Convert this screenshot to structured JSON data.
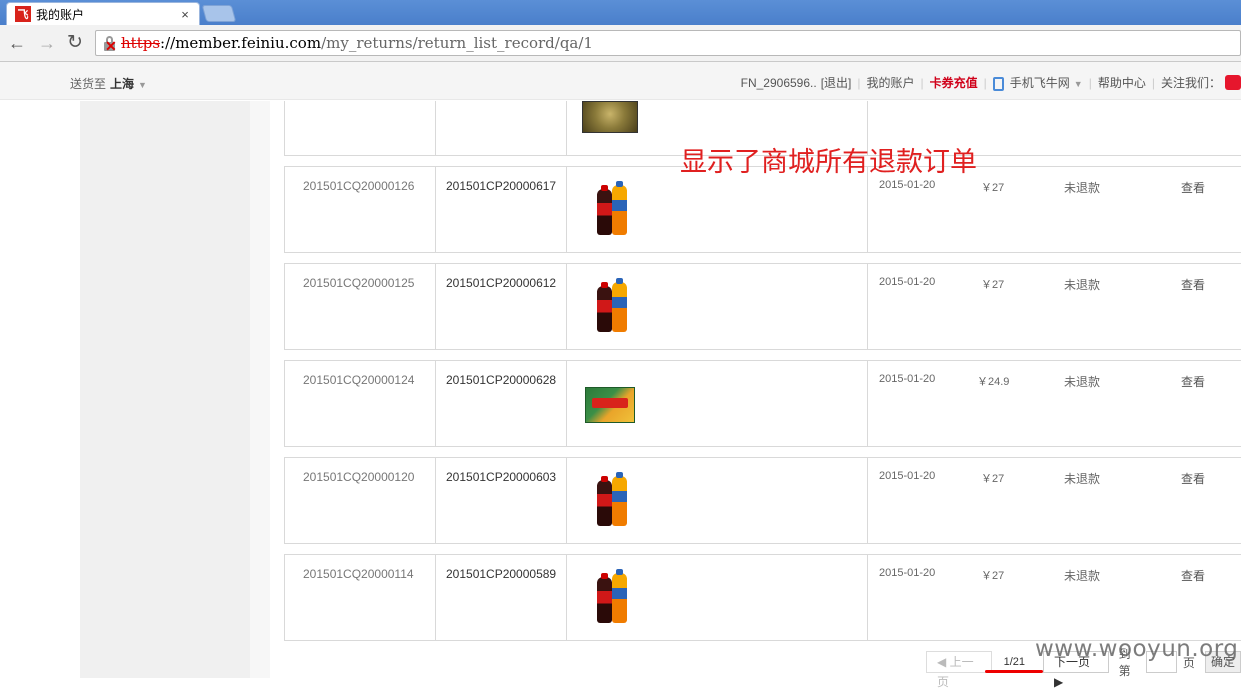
{
  "browser": {
    "tab_title": "我的账户",
    "tab_favicon_text": "飞",
    "tab_close": "×",
    "url_scheme": "https",
    "url_host": "://member.feiniu.com",
    "url_path": "/my_returns/return_list_record/qa/1"
  },
  "topbar": {
    "deliver_label": "送货至",
    "deliver_city": "上海",
    "username": "FN_2906596..",
    "logout": "[退出]",
    "my_account": "我的账户",
    "card_recharge": "卡券充值",
    "mobile_site": "手机飞牛网",
    "help_center": "帮助中心",
    "follow_us": "关注我们："
  },
  "annotation": "显示了商城所有退款订单",
  "orders": [
    {
      "return_no": "201501CQ20000126",
      "order_no": "201501CP20000617",
      "date": "2015-01-20",
      "amount": "￥27",
      "status": "未退款",
      "action": "查看",
      "product": "drinks"
    },
    {
      "return_no": "201501CQ20000125",
      "order_no": "201501CP20000612",
      "date": "2015-01-20",
      "amount": "￥27",
      "status": "未退款",
      "action": "查看",
      "product": "drinks"
    },
    {
      "return_no": "201501CQ20000124",
      "order_no": "201501CP20000628",
      "date": "2015-01-20",
      "amount": "￥24.9",
      "status": "未退款",
      "action": "查看",
      "product": "snack-box"
    },
    {
      "return_no": "201501CQ20000120",
      "order_no": "201501CP20000603",
      "date": "2015-01-20",
      "amount": "￥27",
      "status": "未退款",
      "action": "查看",
      "product": "drinks"
    },
    {
      "return_no": "201501CQ20000114",
      "order_no": "201501CP20000589",
      "date": "2015-01-20",
      "amount": "￥27",
      "status": "未退款",
      "action": "查看",
      "product": "drinks"
    }
  ],
  "pager": {
    "prev": "上一页",
    "current": "1/21",
    "next": "下一页",
    "goto_label": "到第",
    "goto_unit": "页",
    "confirm": "确定"
  },
  "watermark": "www.wooyun.org"
}
